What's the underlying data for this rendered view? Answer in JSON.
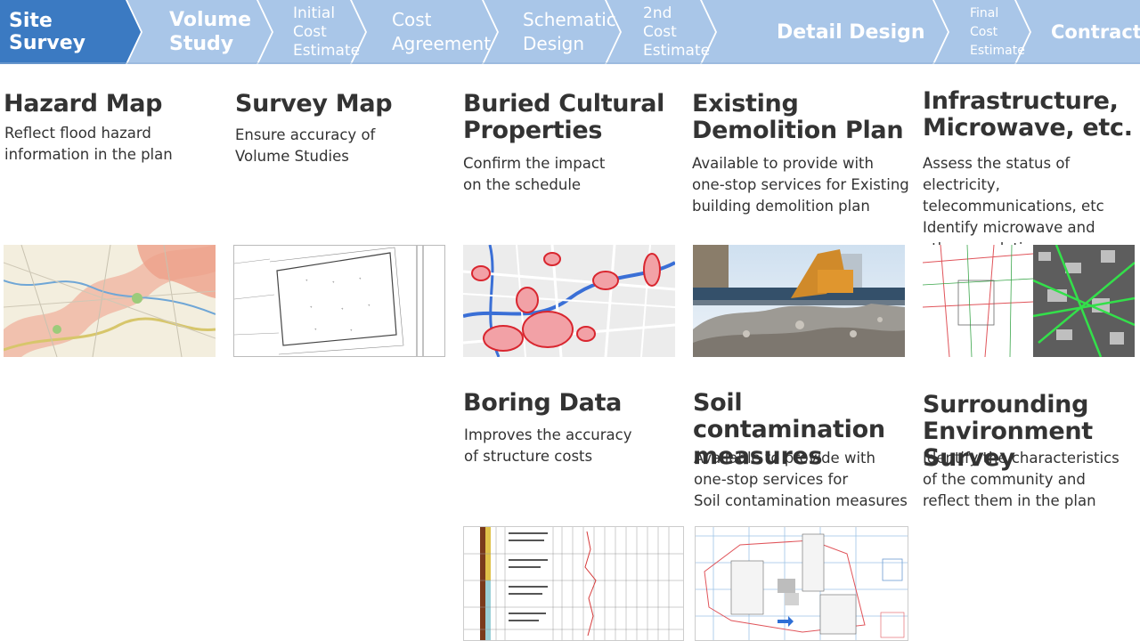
{
  "colors": {
    "active_step": "#3b7ac2",
    "inactive_step": "#a9c6e8",
    "text": "#333333"
  },
  "process_steps": [
    {
      "label": "Site Survey",
      "active": true
    },
    {
      "label": "Volume\nStudy",
      "active": false
    },
    {
      "label": "Initial\nCost\nEstimate",
      "active": false
    },
    {
      "label": "Cost\nAgreement",
      "active": false
    },
    {
      "label": "Schematic\nDesign",
      "active": false
    },
    {
      "label": "2nd\nCost\nEstimate",
      "active": false
    },
    {
      "label": "Detail Design",
      "active": false
    },
    {
      "label": "Final\nCost\nEstimate",
      "active": false
    },
    {
      "label": "Contract",
      "active": false
    }
  ],
  "cards": [
    {
      "title": "Hazard Map",
      "desc": "Reflect flood hazard\ninformation in the plan",
      "icon": "hazard-map-image"
    },
    {
      "title": "Survey Map",
      "desc": "Ensure accuracy of\nVolume Studies",
      "icon": "survey-map-image"
    },
    {
      "title": "Buried Cultural\nProperties",
      "desc": "Confirm the impact\non the schedule",
      "icon": "cultural-properties-map-image"
    },
    {
      "title": "Existing\nDemolition Plan",
      "desc": "Available to provide with\none-stop services for  Existing\nbuilding demolition plan",
      "icon": "demolition-photo-image"
    },
    {
      "title": "Infrastructure,\nMicrowave, etc.",
      "desc": "Assess the status of electricity,\ntelecommunications, etc\nIdentify microwave and\nother regulations",
      "icon": "infrastructure-map-image"
    },
    {
      "title": "Boring Data",
      "desc": "Improves the accuracy\nof structure costs",
      "icon": "boring-log-image"
    },
    {
      "title": "Soil contamination\nmeasures",
      "desc": "Available to provide with\none-stop services for\nSoil contamination measures",
      "icon": "soil-grid-image"
    },
    {
      "title": "Surrounding\nEnvironment Survey",
      "desc": "Identify the characteristics\nof the community and\nreflect them in the plan",
      "icon": "none"
    }
  ]
}
